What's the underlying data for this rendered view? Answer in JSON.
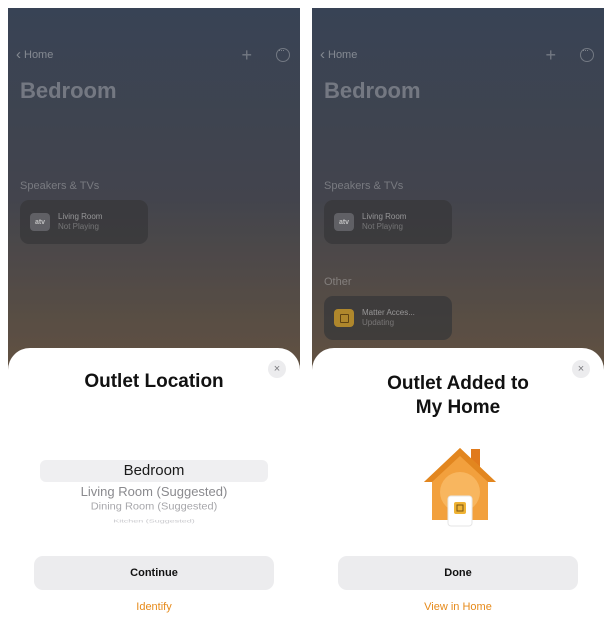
{
  "left": {
    "nav": {
      "back_label": "Home",
      "plus": "+"
    },
    "room_title": "Bedroom",
    "section_speakers": "Speakers & TVs",
    "speaker_tile": {
      "icon_label": "atv",
      "name": "Living Room",
      "status": "Not Playing"
    },
    "sheet": {
      "title": "Outlet Location",
      "close": "×",
      "picker_options": [
        "Bedroom",
        "Living Room (Suggested)",
        "Dining Room (Suggested)",
        "Kitchen (Suggested)"
      ],
      "primary_button": "Continue",
      "link": "Identify"
    }
  },
  "right": {
    "nav": {
      "back_label": "Home",
      "plus": "+"
    },
    "room_title": "Bedroom",
    "section_speakers": "Speakers & TVs",
    "speaker_tile": {
      "icon_label": "atv",
      "name": "Living Room",
      "status": "Not Playing"
    },
    "section_other": "Other",
    "outlet_tile": {
      "name": "Matter Acces...",
      "status": "Updating"
    },
    "sheet": {
      "title_line1": "Outlet Added to",
      "title_line2": "My Home",
      "close": "×",
      "primary_button": "Done",
      "link": "View in Home"
    }
  },
  "colors": {
    "accent_orange": "#e68a1a",
    "house_orange": "#f2a03d"
  }
}
